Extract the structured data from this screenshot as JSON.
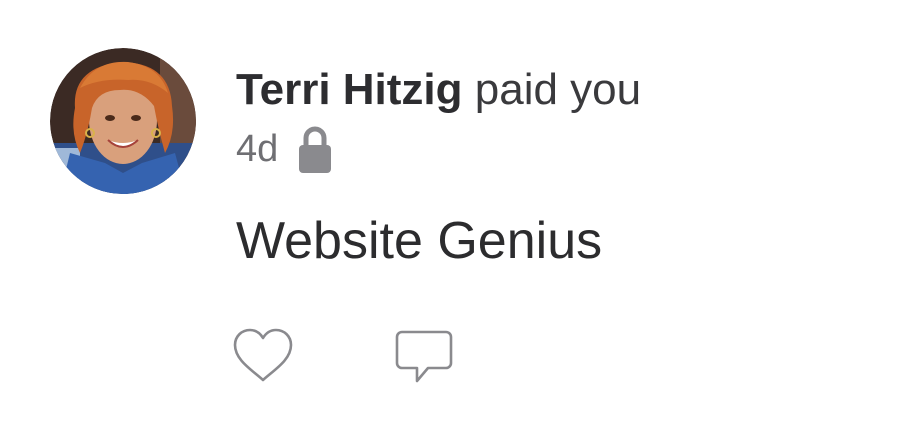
{
  "story": {
    "actor_name": "Terri Hitzig",
    "action_text": "paid you",
    "timestamp": "4d",
    "privacy_icon": "lock-icon",
    "note": "Website Genius"
  },
  "actions": {
    "like_icon": "heart-icon",
    "comment_icon": "speech-bubble-icon"
  },
  "colors": {
    "text_primary": "#2d2d30",
    "text_secondary": "#6f6f73",
    "icon_gray": "#8a8a8e",
    "background": "#ffffff"
  }
}
